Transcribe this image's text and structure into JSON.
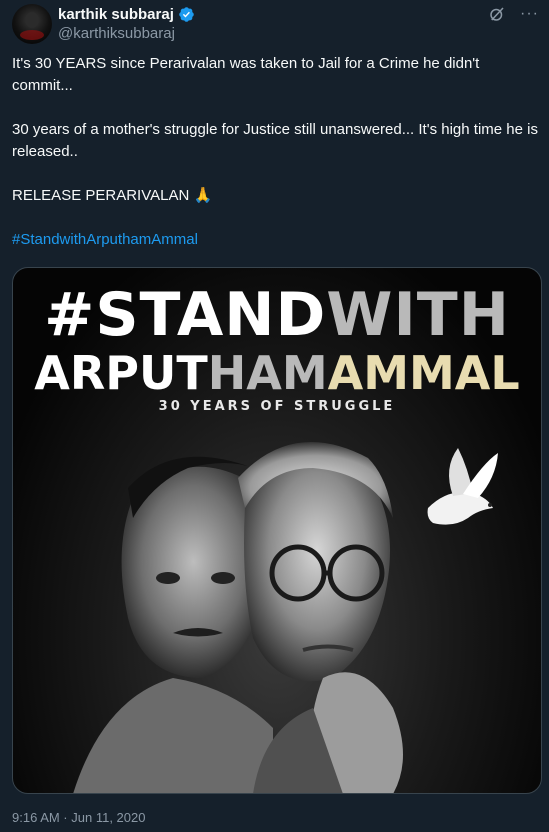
{
  "author": {
    "display_name": "karthik subbaraj",
    "handle": "@karthiksubbaraj"
  },
  "tweet": {
    "lines": [
      "It's 30 YEARS since Perarivalan was taken to Jail for a Crime he didn't commit...",
      "30 years of a mother's struggle for Justice still unanswered... It's high time he is released..",
      "RELEASE PERARIVALAN 🙏",
      "#StandwithArputhamAmmal"
    ]
  },
  "poster": {
    "line1_a": "#STAND",
    "line1_b": "WITH",
    "line2_a": "ARPUT",
    "line2_b": "HAM",
    "line2_c": "AMMAL",
    "subtitle": "30 YEARS OF STRUGGLE"
  },
  "timestamp": "9:16 AM · Jun 11, 2020",
  "colors": {
    "background": "#15202b",
    "text": "#f7f9f9",
    "muted": "#8b98a5",
    "link": "#1d9bf0",
    "verified": "#1d9bf0"
  },
  "icons": {
    "verified": "verified-badge-icon",
    "grok": "grok-icon",
    "more": "more-icon"
  }
}
